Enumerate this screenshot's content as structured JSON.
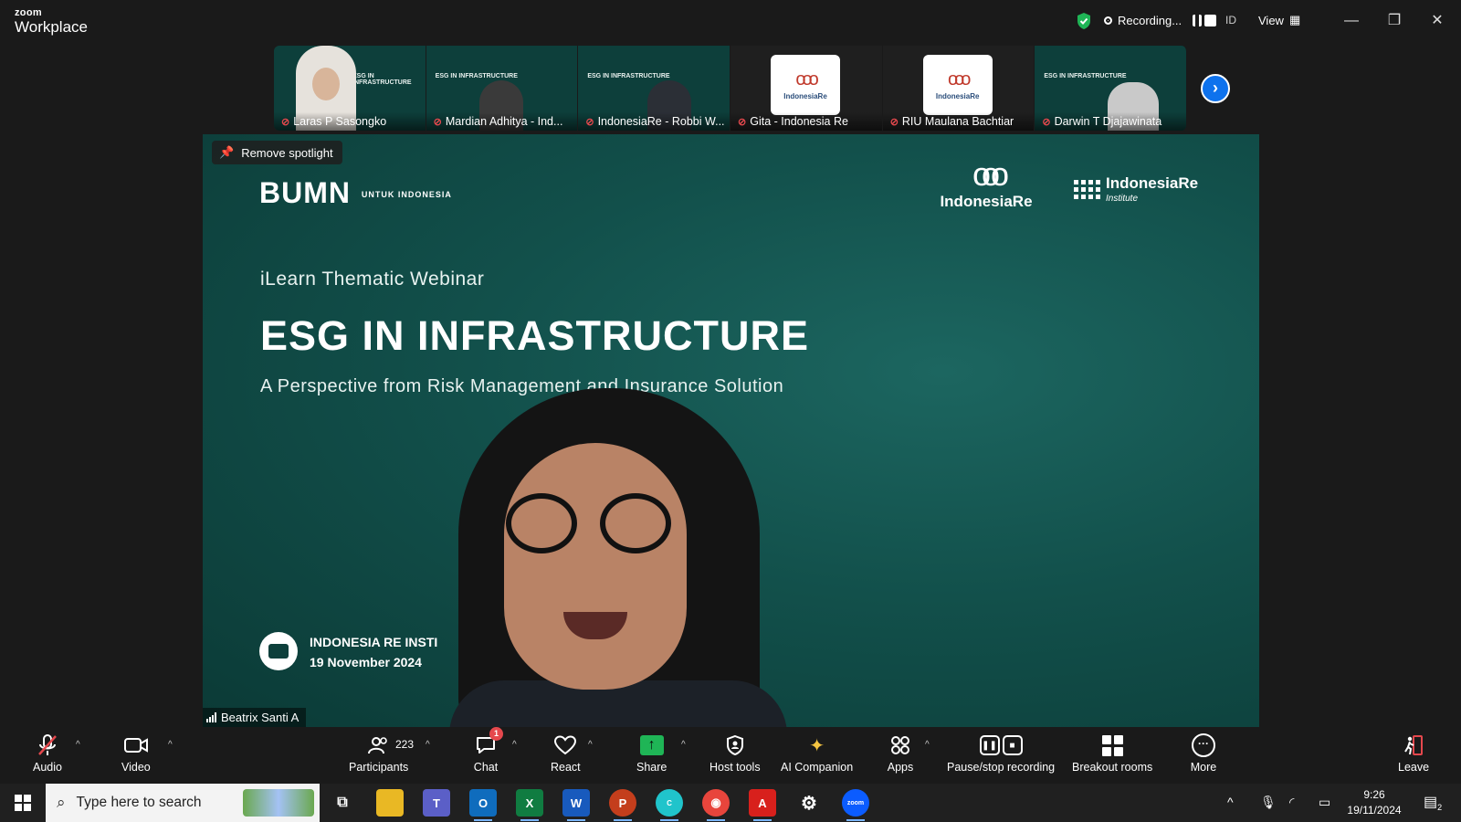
{
  "app": {
    "brand": "zoom",
    "product": "Workplace"
  },
  "topbar": {
    "recording_label": "Recording...",
    "id_label": "ID",
    "view_label": "View"
  },
  "thumbnails": [
    {
      "name": "Laras P Sasongko",
      "kind": "person-hijab"
    },
    {
      "name": "Mardian Adhitya - Ind...",
      "kind": "person"
    },
    {
      "name": "IndonesiaRe - Robbi W...",
      "kind": "person-suit"
    },
    {
      "name": "Gita - Indonesia Re",
      "kind": "avatar"
    },
    {
      "name": "RIU Maulana Bachtiar",
      "kind": "avatar"
    },
    {
      "name": "Darwin T Djajawinata",
      "kind": "person-older"
    }
  ],
  "thumb_slide": {
    "title": "ESG IN INFRASTRUCTURE",
    "card_name": "IndonesiaRe"
  },
  "stage": {
    "spotlight_label": "Remove spotlight",
    "bumn_logo": "BUMN",
    "bumn_sub": "UNTUK INDONESIA",
    "ire_logo": "IndonesiaRe",
    "institute_logo": "IndonesiaRe",
    "institute_sub": "Institute",
    "webinar": "iLearn Thematic Webinar",
    "headline": "ESG IN INFRASTRUCTURE",
    "subheadline": "A Perspective from Risk Management and Insurance Solution",
    "event_org": "INDONESIA RE INSTI",
    "event_date": "19 November 2024",
    "speaker_name": "Beatrix Santi A"
  },
  "toolbar": {
    "audio": "Audio",
    "video": "Video",
    "participants": "Participants",
    "participants_count": "223",
    "chat": "Chat",
    "chat_badge": "1",
    "react": "React",
    "share": "Share",
    "host_tools": "Host tools",
    "ai_companion": "AI Companion",
    "apps": "Apps",
    "pause_stop_recording": "Pause/stop recording",
    "breakout_rooms": "Breakout rooms",
    "more": "More",
    "leave": "Leave"
  },
  "taskbar": {
    "search_placeholder": "Type here to search",
    "time": "9:26",
    "date": "19/11/2024",
    "notification_count": "2"
  },
  "colors": {
    "accent": "#0e72ed",
    "mute": "#e5484d",
    "share": "#1fb556",
    "slide_bg": "#12504b"
  }
}
